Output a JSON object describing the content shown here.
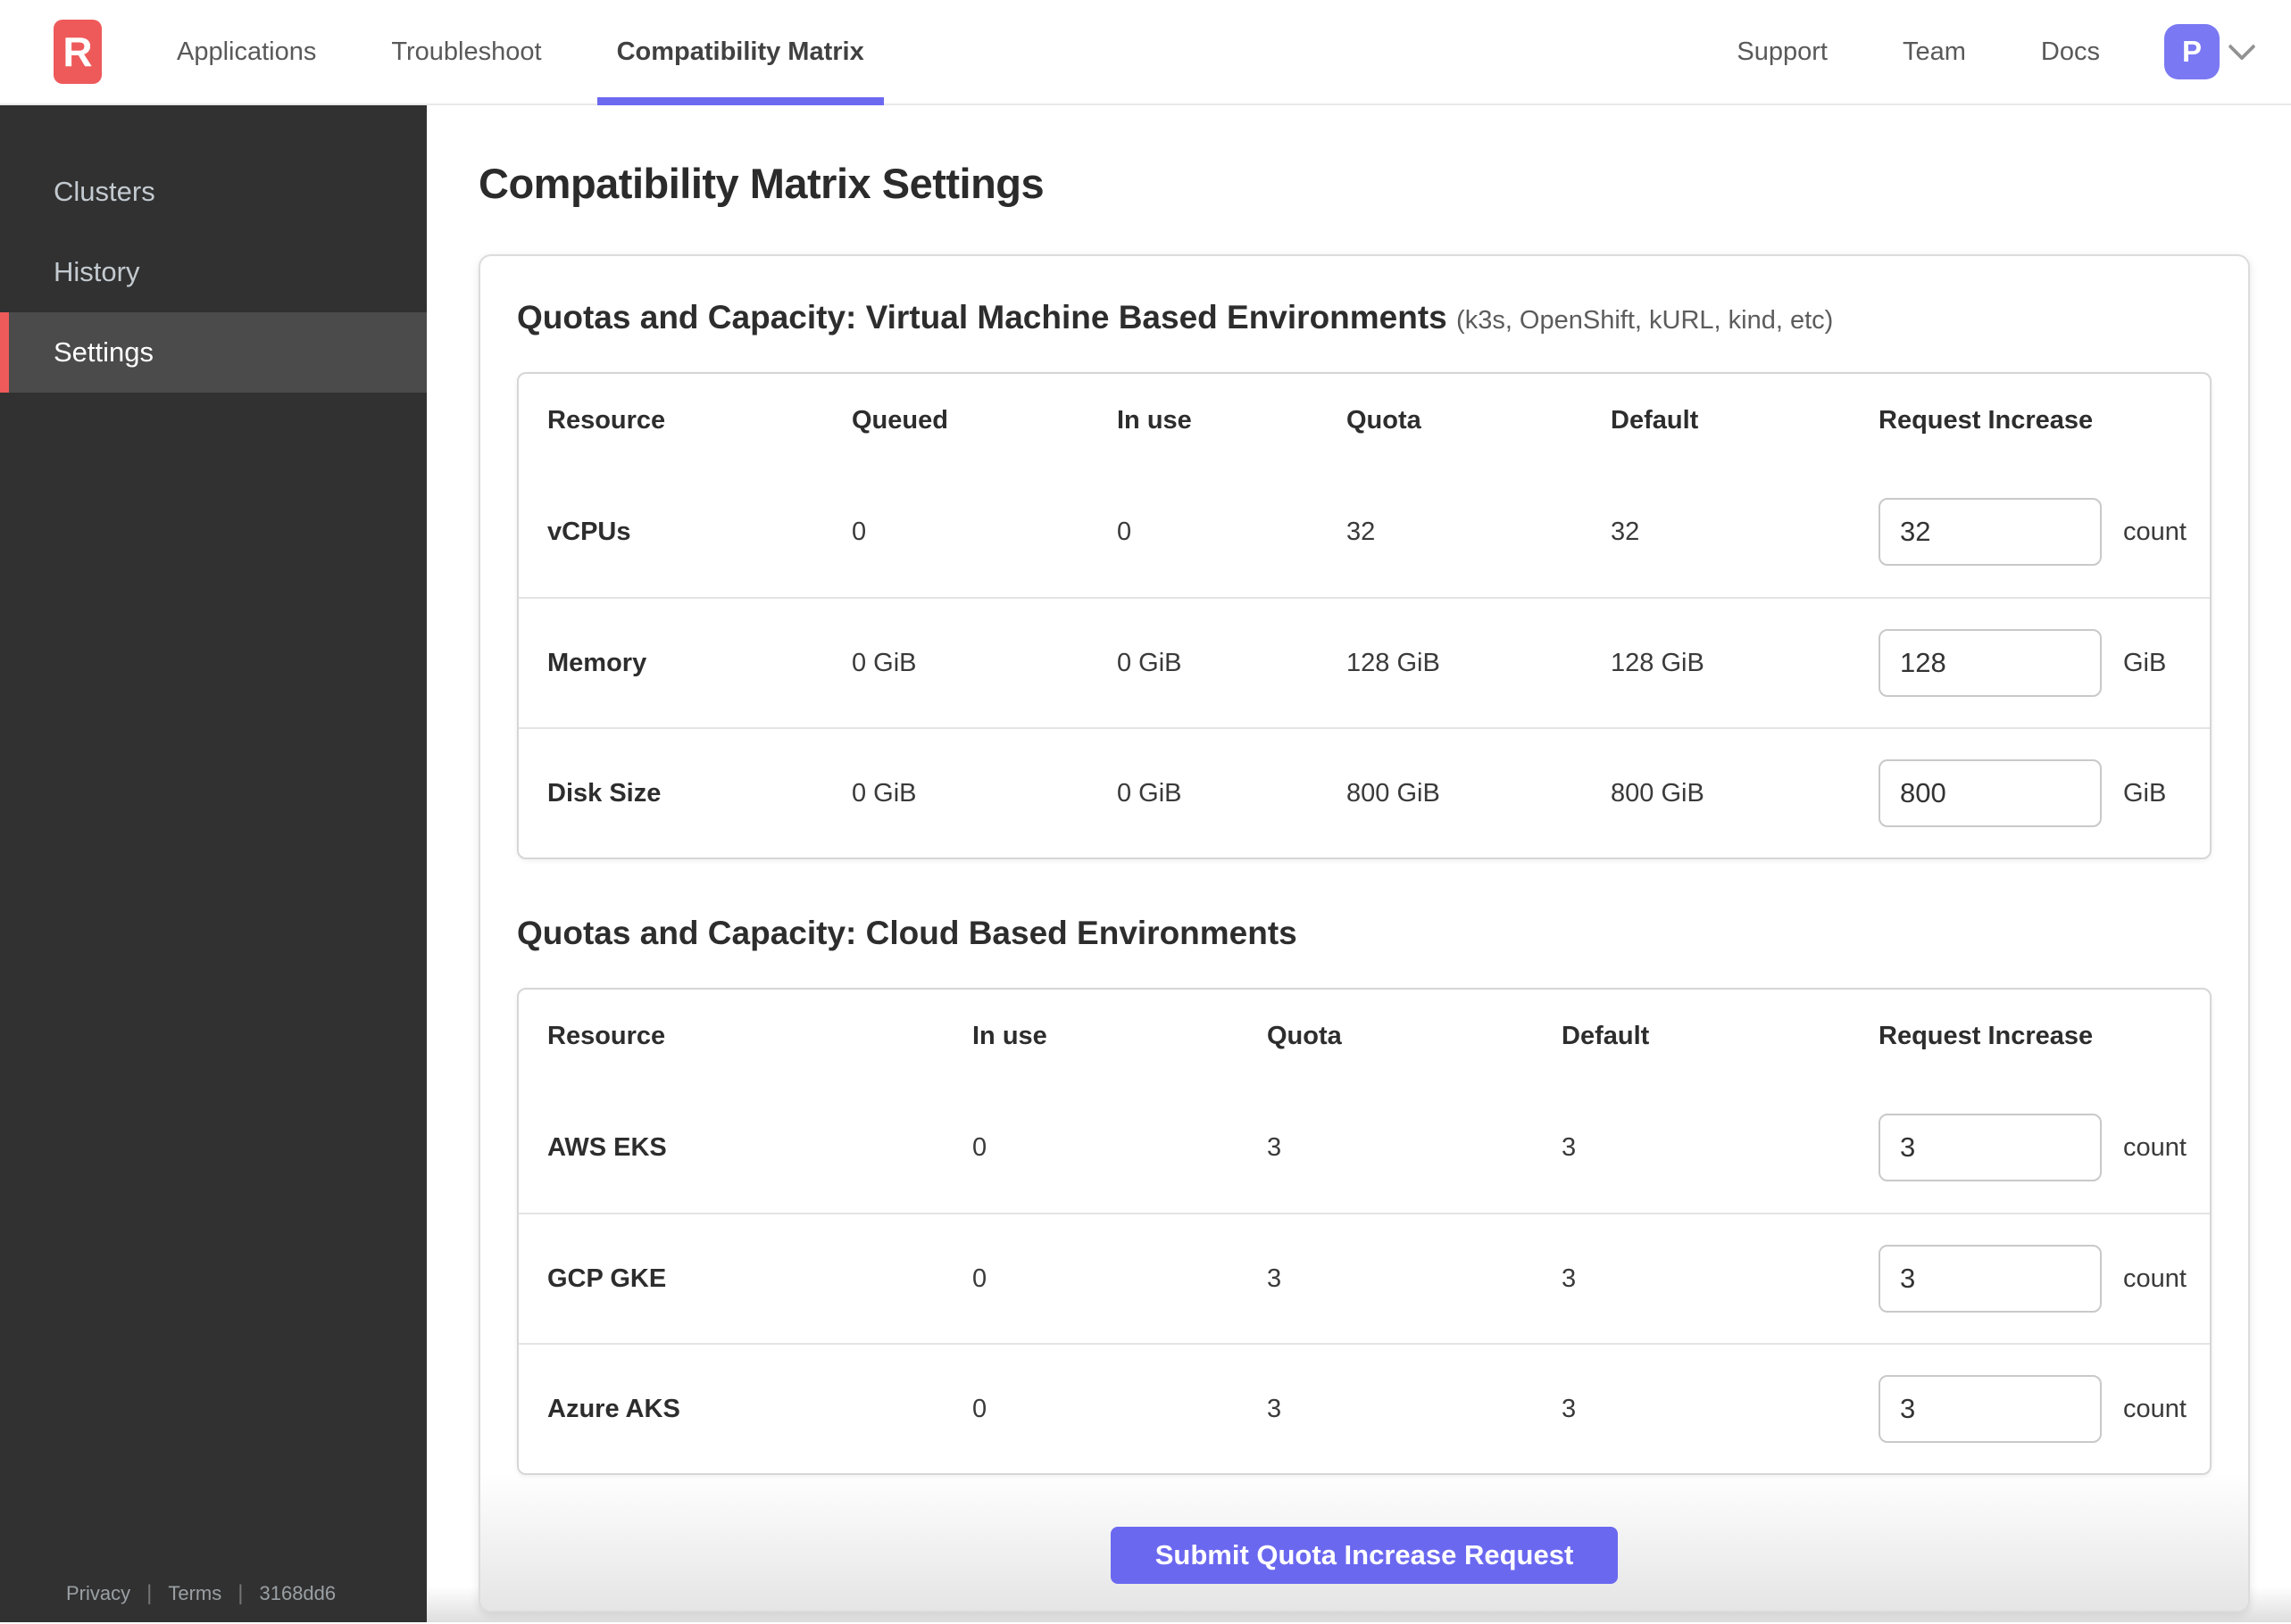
{
  "header": {
    "logo_letter": "R",
    "nav": [
      {
        "label": "Applications",
        "active": false
      },
      {
        "label": "Troubleshoot",
        "active": false
      },
      {
        "label": "Compatibility Matrix",
        "active": true
      }
    ],
    "nav_right": [
      {
        "label": "Support"
      },
      {
        "label": "Team"
      },
      {
        "label": "Docs"
      }
    ],
    "avatar_initial": "P"
  },
  "sidebar": {
    "items": [
      {
        "label": "Clusters",
        "active": false
      },
      {
        "label": "History",
        "active": false
      },
      {
        "label": "Settings",
        "active": true
      }
    ],
    "footer": {
      "privacy": "Privacy",
      "terms": "Terms",
      "build": "3168dd6",
      "separator": "|"
    }
  },
  "main": {
    "page_title": "Compatibility Matrix Settings",
    "sections": [
      {
        "title": "Quotas and Capacity: Virtual Machine Based Environments",
        "subtitle": "(k3s, OpenShift, kURL, kind, etc)",
        "columns": [
          "Resource",
          "Queued",
          "In use",
          "Quota",
          "Default",
          "Request Increase"
        ],
        "rows": [
          {
            "resource": "vCPUs",
            "queued": "0",
            "in_use": "0",
            "quota": "32",
            "default": "32",
            "request_value": "32",
            "unit": "count"
          },
          {
            "resource": "Memory",
            "queued": "0 GiB",
            "in_use": "0 GiB",
            "quota": "128 GiB",
            "default": "128 GiB",
            "request_value": "128",
            "unit": "GiB"
          },
          {
            "resource": "Disk Size",
            "queued": "0 GiB",
            "in_use": "0 GiB",
            "quota": "800 GiB",
            "default": "800 GiB",
            "request_value": "800",
            "unit": "GiB"
          }
        ]
      },
      {
        "title": "Quotas and Capacity: Cloud Based Environments",
        "subtitle": "",
        "columns": [
          "Resource",
          "In use",
          "Quota",
          "Default",
          "Request Increase"
        ],
        "rows": [
          {
            "resource": "AWS EKS",
            "in_use": "0",
            "quota": "3",
            "default": "3",
            "request_value": "3",
            "unit": "count"
          },
          {
            "resource": "GCP GKE",
            "in_use": "0",
            "quota": "3",
            "default": "3",
            "request_value": "3",
            "unit": "count"
          },
          {
            "resource": "Azure AKS",
            "in_use": "0",
            "quota": "3",
            "default": "3",
            "request_value": "3",
            "unit": "count"
          }
        ]
      }
    ],
    "submit_label": "Submit Quota Increase Request"
  },
  "colors": {
    "brand_red": "#ee5a5a",
    "accent_purple": "#6b68f0",
    "avatar_purple": "#7b78f3",
    "sidebar_bg": "#313131",
    "sidebar_active_bg": "#4b4b4b",
    "table_border": "#d6d6d6",
    "input_border": "#c9c9c9"
  }
}
